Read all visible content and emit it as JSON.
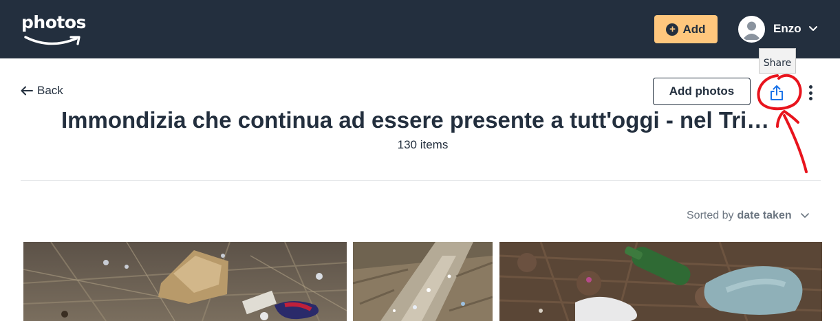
{
  "header": {
    "logo_text": "photos",
    "add_label": "Add",
    "user_name": "Enzo"
  },
  "tooltip": {
    "text": "Share"
  },
  "album": {
    "back_label": "Back",
    "add_photos_label": "Add photos",
    "title": "Immondizia che continua ad essere presente a tutt'oggi - nel Tri…",
    "item_count": "130 items"
  },
  "sort": {
    "prefix": "Sorted by",
    "value": "date taken"
  },
  "icons": {
    "back": "arrow-left-icon",
    "share": "share-icon",
    "more": "more-vertical-icon",
    "chevron": "chevron-down-icon",
    "avatar": "user-avatar-icon",
    "add": "plus-circle-icon"
  },
  "colors": {
    "header_bg": "#232f3e",
    "add_button": "#ffc77d",
    "share_icon": "#1a73e8",
    "annotation": "#e8141d",
    "text": "#232f3e",
    "muted": "#6c7681"
  },
  "photos": [
    {
      "name": "photo-trash-cardboard"
    },
    {
      "name": "photo-trash-path"
    },
    {
      "name": "photo-trash-bottle"
    }
  ]
}
